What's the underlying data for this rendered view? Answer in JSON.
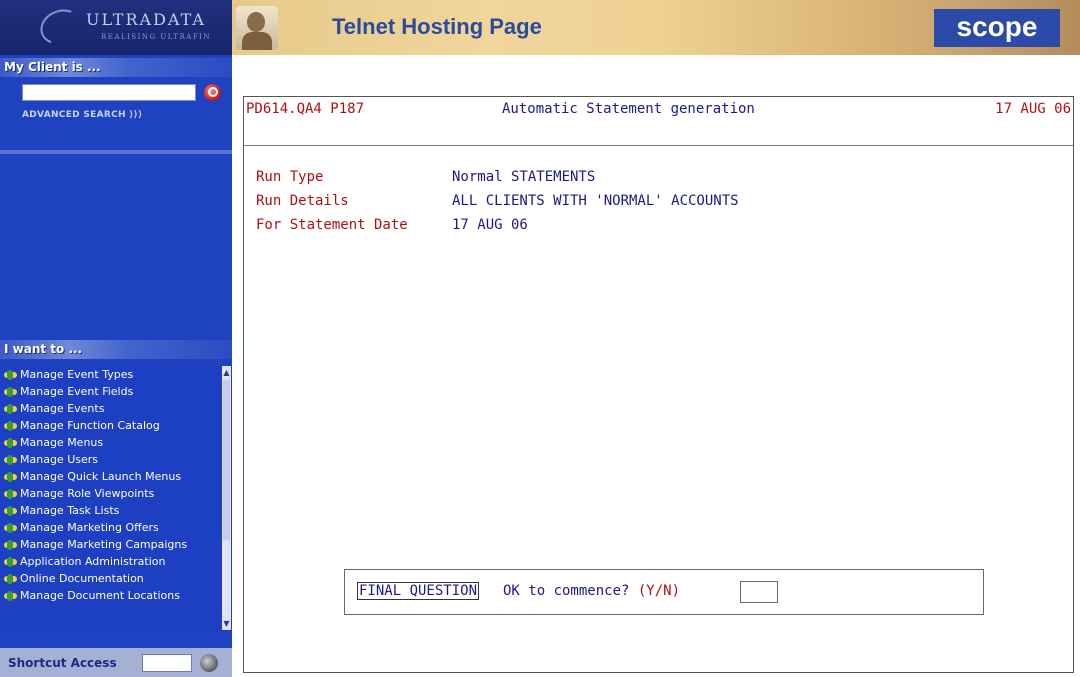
{
  "brand": {
    "name": "ULTRADATA",
    "tagline": "REALISING ULTRAFIN"
  },
  "header": {
    "title": "Telnet Hosting Page",
    "logo": "scope"
  },
  "sidebar": {
    "client_heading": "My Client is ...",
    "search_value": "",
    "advanced_search": "ADVANCED SEARCH ⟩⟩⟩",
    "iwant_heading": "I want to ...",
    "items": [
      {
        "label": "Manage Event Types"
      },
      {
        "label": "Manage Event Fields"
      },
      {
        "label": "Manage Events"
      },
      {
        "label": "Manage Function Catalog"
      },
      {
        "label": "Manage Menus"
      },
      {
        "label": "Manage Users"
      },
      {
        "label": "Manage Quick Launch Menus"
      },
      {
        "label": "Manage Role Viewpoints"
      },
      {
        "label": "Manage Task Lists"
      },
      {
        "label": "Manage Marketing Offers"
      },
      {
        "label": "Manage Marketing Campaigns"
      },
      {
        "label": "Application Administration"
      },
      {
        "label": "Online Documentation"
      },
      {
        "label": "Manage Document Locations"
      }
    ],
    "shortcut_label": "Shortcut Access",
    "shortcut_value": ""
  },
  "terminal": {
    "program": "PD614.QA4 P187",
    "title": "Automatic Statement generation",
    "date": "17 AUG 06",
    "rows": [
      {
        "key": "Run Type",
        "value": "Normal STATEMENTS"
      },
      {
        "key": "Run Details",
        "value": "ALL CLIENTS WITH 'NORMAL' ACCOUNTS"
      },
      {
        "key": "For Statement Date",
        "value": "17 AUG 06"
      }
    ],
    "final_label": "FINAL QUESTION",
    "final_text": "OK to commence?",
    "final_yn": "(Y/N)",
    "final_value": ""
  },
  "icons": {
    "search": "search-icon",
    "go": "go-icon",
    "menu_item": "menu-item-icon",
    "scroll_up": "arrow-up-icon",
    "scroll_down": "arrow-down-icon"
  }
}
